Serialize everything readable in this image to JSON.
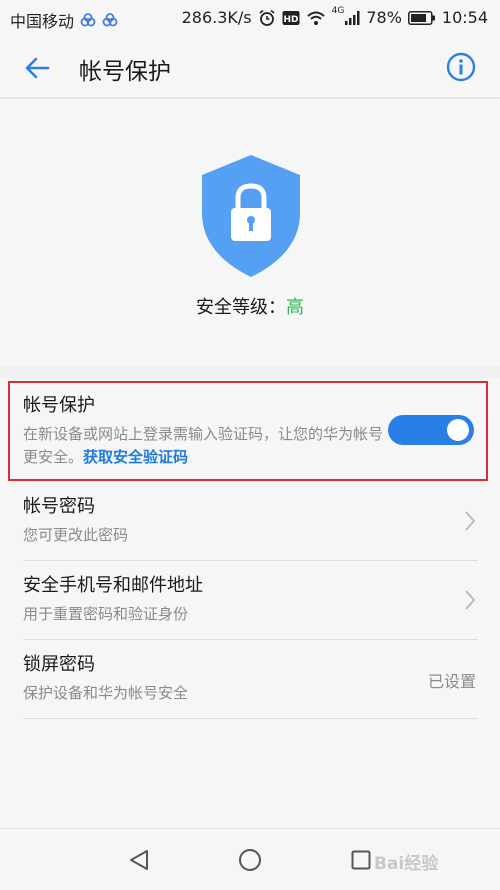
{
  "status_bar": {
    "carrier": "中国移动",
    "speed": "286.3K/s",
    "network": "4G",
    "battery": "78%",
    "time": "10:54",
    "icons": [
      "cloud-icon",
      "cloud-icon",
      "alarm-icon",
      "hd-icon",
      "wifi-icon",
      "signal-icon",
      "battery-icon"
    ]
  },
  "header": {
    "title": "帐号保护"
  },
  "hero": {
    "level_label": "安全等级：",
    "level_value": "高",
    "level_color": "#33b552",
    "shield_color": "#55a0f2"
  },
  "account_protection": {
    "title": "帐号保护",
    "description": "在新设备或网站上登录需输入验证码，让您的华为帐号更安全。",
    "link_text": "获取安全验证码",
    "toggle_on": true
  },
  "settings": [
    {
      "title": "帐号密码",
      "subtitle": "您可更改此密码",
      "right_text": ""
    },
    {
      "title": "安全手机号和邮件地址",
      "subtitle": "用于重置密码和验证身份",
      "right_text": ""
    },
    {
      "title": "锁屏密码",
      "subtitle": "保护设备和华为帐号安全",
      "right_text": "已设置"
    }
  ],
  "watermark": "Bai经验",
  "colors": {
    "accent": "#2a7fe6",
    "highlight_border": "#d62f3a"
  }
}
